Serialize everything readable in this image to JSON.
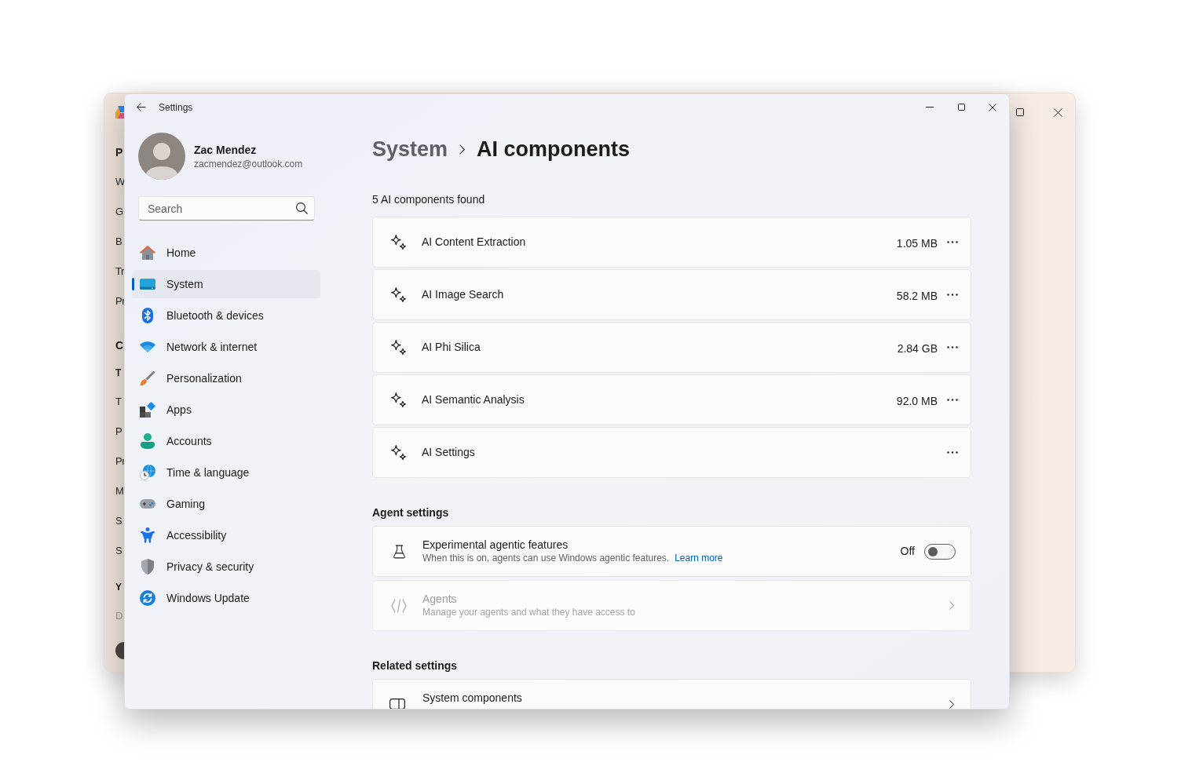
{
  "background_window": {
    "fragments": [
      {
        "text": "P",
        "kind": "heading"
      },
      {
        "text": "W",
        "kind": "item"
      },
      {
        "text": "G",
        "kind": "item"
      },
      {
        "text": "B",
        "kind": "item"
      },
      {
        "text": "Tr",
        "kind": "item"
      },
      {
        "text": "Pr",
        "kind": "item"
      },
      {
        "text": "C",
        "kind": "heading"
      },
      {
        "text": "T",
        "kind": "subheading"
      },
      {
        "text": "T",
        "kind": "item"
      },
      {
        "text": "P",
        "kind": "item"
      },
      {
        "text": "Pr",
        "kind": "item"
      },
      {
        "text": "M",
        "kind": "item"
      },
      {
        "text": "S",
        "kind": "item"
      },
      {
        "text": "S",
        "kind": "item"
      },
      {
        "text": "Y",
        "kind": "subheading"
      },
      {
        "text": "D",
        "kind": "disabled"
      }
    ]
  },
  "settings_window": {
    "title": "Settings",
    "user": {
      "name": "Zac Mendez",
      "email": "zacmendez@outlook.com"
    },
    "search": {
      "placeholder": "Search"
    },
    "nav": [
      {
        "label": "Home",
        "selected": false
      },
      {
        "label": "System",
        "selected": true
      },
      {
        "label": "Bluetooth & devices",
        "selected": false
      },
      {
        "label": "Network & internet",
        "selected": false
      },
      {
        "label": "Personalization",
        "selected": false
      },
      {
        "label": "Apps",
        "selected": false
      },
      {
        "label": "Accounts",
        "selected": false
      },
      {
        "label": "Time & language",
        "selected": false
      },
      {
        "label": "Gaming",
        "selected": false
      },
      {
        "label": "Accessibility",
        "selected": false
      },
      {
        "label": "Privacy & security",
        "selected": false
      },
      {
        "label": "Windows Update",
        "selected": false
      }
    ],
    "breadcrumb": [
      {
        "label": "System",
        "current": false
      },
      {
        "label": "AI components",
        "current": true
      }
    ],
    "count_text": "5 AI components found",
    "components": [
      {
        "name": "AI Content Extraction",
        "size": "1.05 MB"
      },
      {
        "name": "AI Image Search",
        "size": "58.2 MB"
      },
      {
        "name": "AI Phi Silica",
        "size": "2.84 GB"
      },
      {
        "name": "AI Semantic Analysis",
        "size": "92.0 MB"
      },
      {
        "name": "AI Settings"
      }
    ],
    "agent_settings": {
      "heading": "Agent settings",
      "items": [
        {
          "kind": "toggle",
          "title": "Experimental agentic features",
          "description": "When this is on, agents can use Windows agentic features.",
          "link": "Learn more",
          "state_label": "Off",
          "on": false,
          "disabled": false
        },
        {
          "kind": "link",
          "title": "Agents",
          "description": "Manage your agents and what they have access to",
          "disabled": true
        }
      ]
    },
    "related_settings": {
      "heading": "Related settings",
      "items": [
        {
          "title": "System components"
        }
      ]
    }
  }
}
